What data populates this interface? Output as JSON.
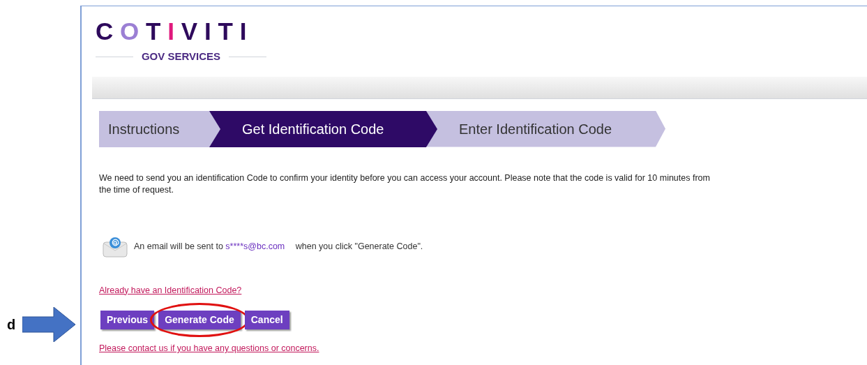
{
  "logo": {
    "wordmark": "COTIVITI",
    "tagline": "GOV SERVICES"
  },
  "steps": [
    {
      "label": "Instructions",
      "selected": false
    },
    {
      "label": "Get Identification Code",
      "selected": true
    },
    {
      "label": "Enter Identification Code",
      "selected": false
    }
  ],
  "intro_lines": [
    "We need to send you an identification Code to confirm your identity before you can access your account. Please note that the code is valid for 10 minutes from",
    "the time of request."
  ],
  "email_notice": {
    "before": "An email will be sent to",
    "email": "s****s@bc.com",
    "after": "when you click \"Generate Code\"."
  },
  "already_link": "Already have an Identification Code?",
  "buttons": [
    {
      "label": "Previous",
      "circled": false
    },
    {
      "label": "Generate Code",
      "circled": true
    },
    {
      "label": "Cancel",
      "circled": false
    }
  ],
  "contact_link": "Please contact us if you have any questions or concerns.",
  "annotation": {
    "label": "d"
  }
}
